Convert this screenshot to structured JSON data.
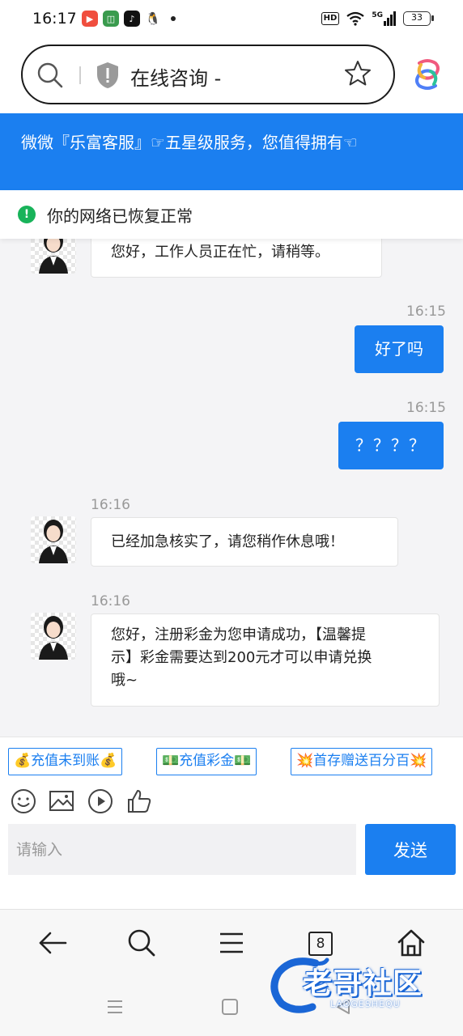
{
  "status_bar": {
    "time": "16:17",
    "network": "5G",
    "battery": "33"
  },
  "address_bar": {
    "title": "在线咨询 -"
  },
  "banner": {
    "text": "微微『乐富客服』☞五星级服务，您值得拥有☜"
  },
  "network_notice": {
    "text": "你的网络已恢复正常"
  },
  "chat": {
    "messages": [
      {
        "side": "in",
        "time": "",
        "text": "您好，工作人员正在忙，请稍等。"
      },
      {
        "side": "out",
        "time": "16:15",
        "text": "好了吗"
      },
      {
        "side": "out",
        "time": "16:15",
        "text": "？？？？"
      },
      {
        "side": "in",
        "time": "16:16",
        "text": "已经加急核实了，请您稍作休息哦！"
      },
      {
        "side": "in",
        "time": "16:16",
        "line1": "您好，注册彩金为您申请成功，【温馨提",
        "line2": "示】彩金需要达到200元才可以申请兑换",
        "line3": "哦~"
      }
    ]
  },
  "quick_tags": [
    "💰充值未到账💰",
    "💵充值彩金💵",
    "💥首存赠送百分百💥"
  ],
  "input": {
    "placeholder": "请输入",
    "send_label": "发送"
  },
  "browser_nav": {
    "tab_count": "8"
  },
  "watermark": {
    "text": "老哥社区",
    "sub": "LAOGESHEQU"
  },
  "colors": {
    "accent": "#1b7ff0",
    "success": "#18b35a"
  }
}
